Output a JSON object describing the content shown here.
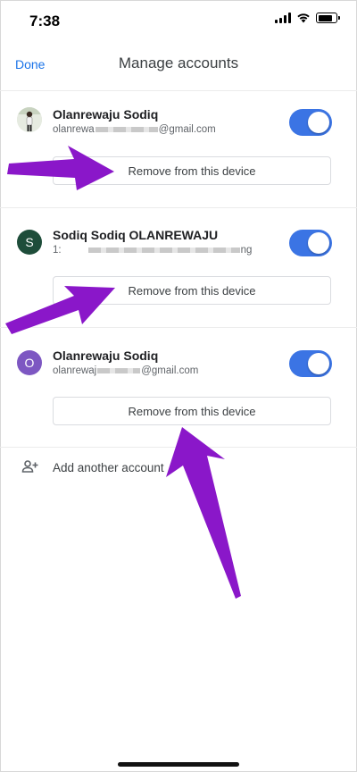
{
  "status_bar": {
    "time": "7:38"
  },
  "header": {
    "done_label": "Done",
    "title": "Manage accounts"
  },
  "accounts": [
    {
      "name": "Olanrewaju Sodiq",
      "email_start": "olanrewa",
      "email_end": "@gmail.com",
      "avatar_type": "photo",
      "toggle_on": true,
      "remove_label": "Remove from this device"
    },
    {
      "name": "Sodiq Sodiq OLANREWAJU",
      "email_start": "1:",
      "email_end": "ng",
      "avatar_letter": "S",
      "avatar_color": "#1e4d3a",
      "toggle_on": true,
      "remove_label": "Remove from this device"
    },
    {
      "name": "Olanrewaju Sodiq",
      "email_start": "olanrewaj",
      "email_end": "@gmail.com",
      "avatar_letter": "O",
      "avatar_color": "#7d57c2",
      "toggle_on": true,
      "remove_label": "Remove from this device"
    }
  ],
  "add_account": {
    "label": "Add another account",
    "icon": "add-person-icon"
  },
  "colors": {
    "accent": "#1a73e8",
    "toggle": "#3b74e4",
    "annotation_arrow": "#8a17c9"
  }
}
